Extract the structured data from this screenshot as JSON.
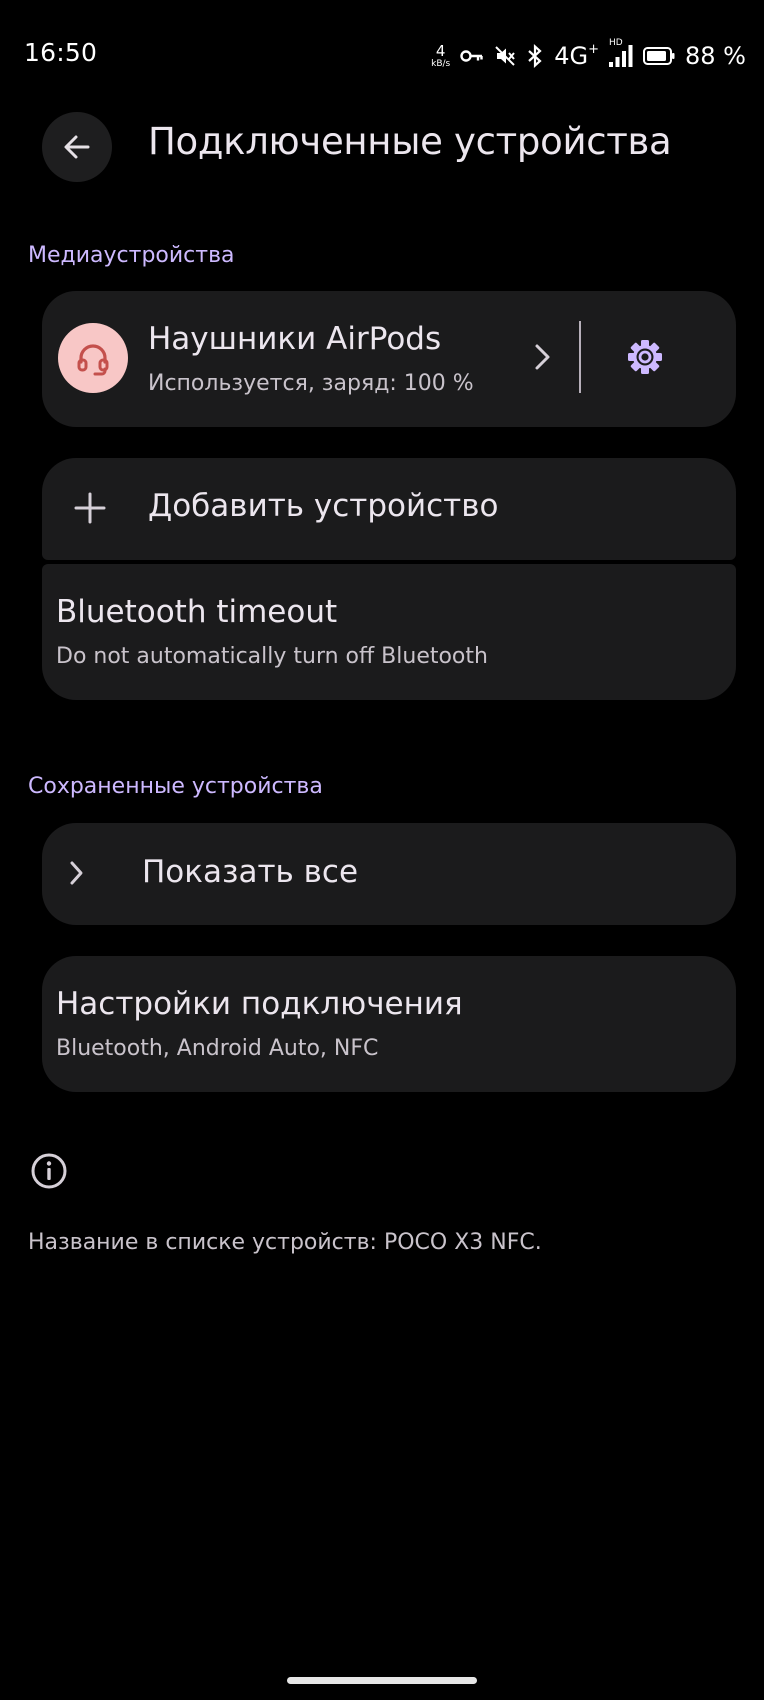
{
  "status_bar": {
    "time": "16:50",
    "speed_value": "4",
    "speed_unit": "kB/s",
    "network": "4G",
    "network_sup": "+",
    "hd": "HD",
    "battery": "88 %"
  },
  "header": {
    "title": "Подключенные устройства"
  },
  "media_section": {
    "label": "Медиаустройства",
    "device": {
      "name": "Наушники AirPods",
      "status": "Используется, заряд: 100 %",
      "icon": "headset-icon"
    },
    "add_device_label": "Добавить устройство",
    "bluetooth_timeout": {
      "title": "Bluetooth timeout",
      "subtitle": "Do not automatically turn off Bluetooth"
    }
  },
  "saved_section": {
    "label": "Сохраненные устройства",
    "show_all_label": "Показать все"
  },
  "connection_settings": {
    "title": "Настройки подключения",
    "subtitle": "Bluetooth, Android Auto, NFC"
  },
  "footer": {
    "device_name_text": "Название в списке устройств: POCO X3 NFC."
  },
  "colors": {
    "background": "#000000",
    "card": "#1b1b1c",
    "accent": "#cdb9ff",
    "avatar_bg": "#f8c7c6",
    "avatar_icon": "#c4504c"
  }
}
